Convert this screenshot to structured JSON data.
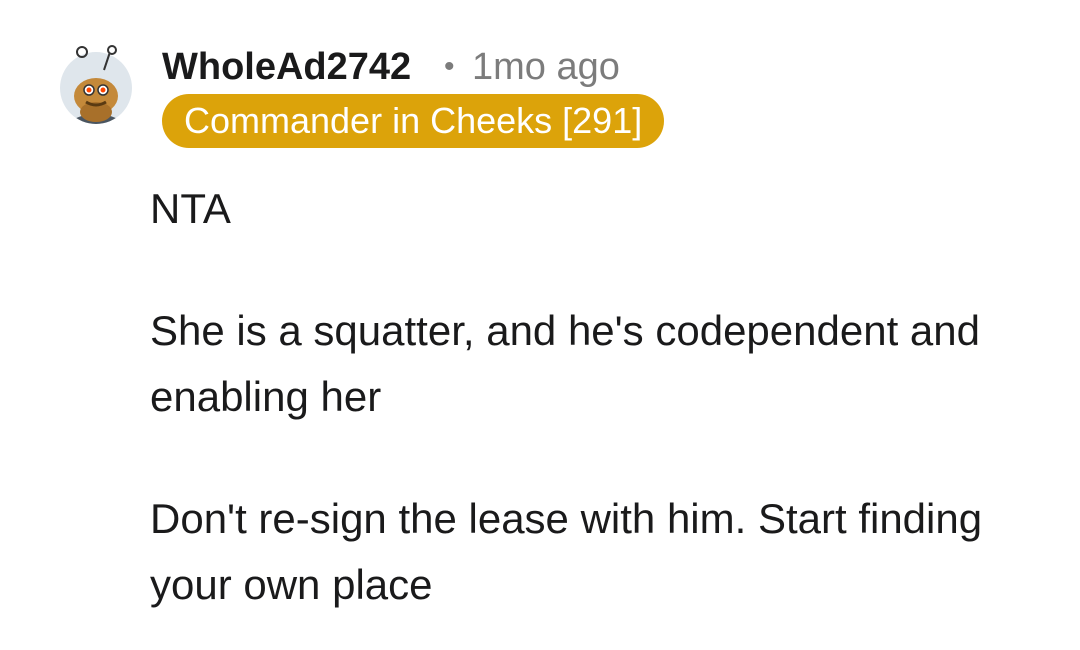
{
  "comment": {
    "username": "WholeAd2742",
    "separator": "•",
    "timestamp": "1mo ago",
    "flair": {
      "text": "Commander in Cheeks [291]",
      "background": "#dca30a",
      "color": "#ffffff"
    },
    "avatar_icon": "snoo-avatar-icon",
    "paragraphs": [
      "NTA",
      "She is a squatter, and he's codependent and enabling her",
      "Don't re-sign the lease with him. Start finding your own place"
    ]
  }
}
